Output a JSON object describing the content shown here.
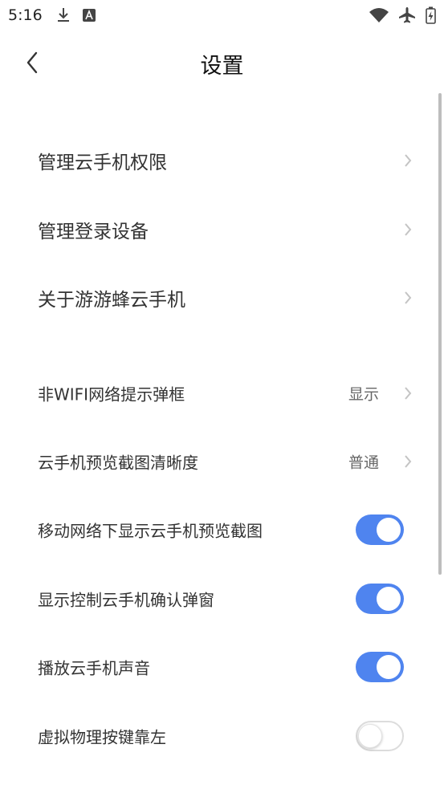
{
  "status_bar": {
    "time": "5:16",
    "left_icons": [
      "download-icon",
      "text-a-icon"
    ],
    "right_icons": [
      "wifi-icon",
      "airplane-icon",
      "battery-charging-icon"
    ]
  },
  "header": {
    "title": "设置",
    "back_icon": "chevron-left-icon"
  },
  "section_1": [
    {
      "label": "管理云手机权限"
    },
    {
      "label": "管理登录设备"
    },
    {
      "label": "关于游游蜂云手机"
    }
  ],
  "section_2": {
    "wifi_prompt": {
      "label": "非WIFI网络提示弹框",
      "value": "显示"
    },
    "preview_quality": {
      "label": "云手机预览截图清晰度",
      "value": "普通"
    },
    "toggles": [
      {
        "label": "移动网络下显示云手机预览截图",
        "on": true
      },
      {
        "label": "显示控制云手机确认弹窗",
        "on": true
      },
      {
        "label": "播放云手机声音",
        "on": true
      },
      {
        "label": "虚拟物理按键靠左",
        "on": false
      }
    ]
  },
  "colors": {
    "accent": "#4f84ef",
    "text": "#333333",
    "value_text": "#666666",
    "chevron": "#c4c4c4"
  }
}
